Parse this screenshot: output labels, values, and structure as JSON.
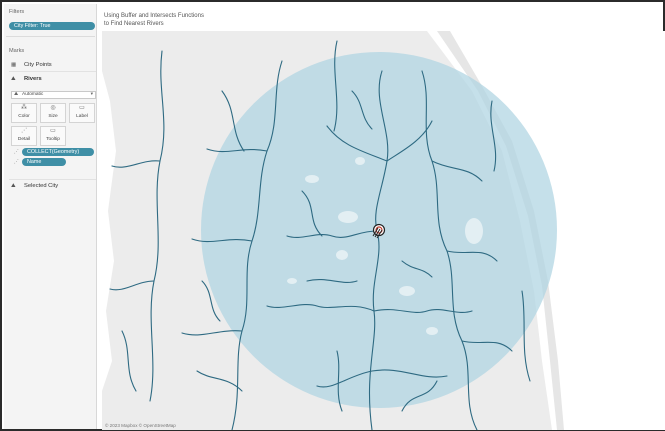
{
  "filters": {
    "title": "Filters",
    "pill": "City Filter: True"
  },
  "marks": {
    "title": "Marks",
    "layers": [
      {
        "label": "City Points",
        "icon": "grid-icon"
      },
      {
        "label": "Rivers",
        "icon": "map-layer-icon"
      }
    ],
    "mark_type": "Automatic",
    "buttons": [
      {
        "label": "Color",
        "icon": "color-icon"
      },
      {
        "label": "Size",
        "icon": "size-icon"
      },
      {
        "label": "Label",
        "icon": "label-icon"
      },
      {
        "label": "Detail",
        "icon": "detail-icon"
      },
      {
        "label": "Tooltip",
        "icon": "tooltip-icon"
      }
    ],
    "fields": [
      "COLLECT(Geometry)",
      "Name"
    ],
    "selected_layer": "Selected City"
  },
  "view": {
    "title_line1": "Using Buffer and Intersects Functions",
    "title_line2": "to Find Nearest Rivers",
    "attribution": "© 2023 Mapbox © OpenStreetMap"
  },
  "colors": {
    "buffer": "#aed4e2",
    "river": "#2e6a82",
    "pill": "#3f8fa6",
    "land": "#ececec",
    "water": "#ffffff"
  }
}
